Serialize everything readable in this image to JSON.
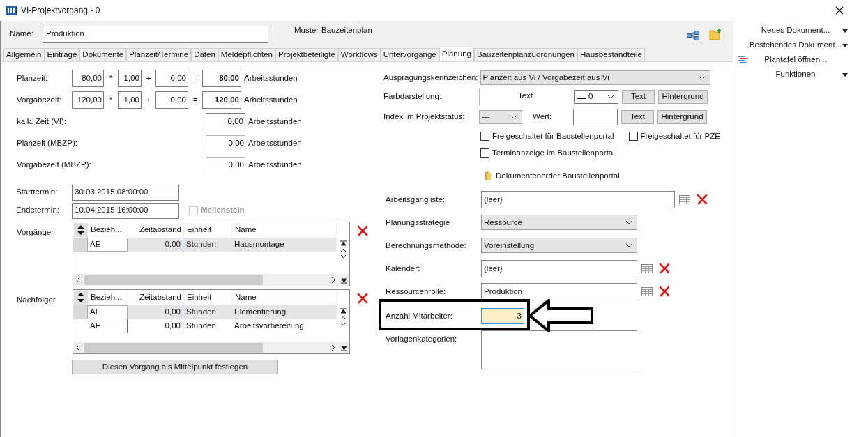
{
  "window": {
    "title": "VI-Projektvorgang - 0"
  },
  "header": {
    "name_label": "Name:",
    "name_value": "Produktion",
    "template": "Muster-Bauzeitenplan"
  },
  "tabs": [
    {
      "label": "Allgemein",
      "selected": false
    },
    {
      "label": "Einträge",
      "selected": false
    },
    {
      "label": "Dokumente",
      "selected": false
    },
    {
      "label": "Planzeit/Termine",
      "selected": false
    },
    {
      "label": "Daten",
      "selected": false
    },
    {
      "label": "Meldepflichten",
      "selected": false
    },
    {
      "label": "Projektbeteiligte",
      "selected": false
    },
    {
      "label": "Workflows",
      "selected": false
    },
    {
      "label": "Untervorgänge",
      "selected": false
    },
    {
      "label": "Planung",
      "selected": true
    },
    {
      "label": "Bauzeitenplanzuordnungen",
      "selected": false
    },
    {
      "label": "Hausbestandteile",
      "selected": false
    }
  ],
  "time_rows": [
    {
      "kind": "formula",
      "label": "Planzeit:",
      "base": "80,00",
      "factor": "1,00",
      "summand": "0,00",
      "result": "80,00",
      "unit": "Arbeitsstunden"
    },
    {
      "kind": "formula",
      "label": "Vorgabezeit:",
      "base": "120,00",
      "factor": "1,00",
      "summand": "0,00",
      "result": "120,00",
      "unit": "Arbeitsstunden"
    },
    {
      "kind": "input",
      "label": "kalk. Zeit (VI):",
      "result": "0,00",
      "unit": "Arbeitsstunden"
    },
    {
      "kind": "readonly",
      "label": "Planzeit (MBZP):",
      "result": "0,00",
      "unit": "Arbeitsstunden"
    },
    {
      "kind": "readonly",
      "label": "Vorgabezeit (MBZP):",
      "result": "0,00",
      "unit": "Arbeitsstunden"
    }
  ],
  "operators": {
    "times": "*",
    "plus": "+",
    "equals": "="
  },
  "dates": [
    {
      "label": "Starttermin:",
      "value": "30.03.2015 08:00:00"
    },
    {
      "label": "Endetermin:",
      "value": "10.04.2015 16:00:00"
    }
  ],
  "milestone": {
    "label": "Meilenstein",
    "checked": false,
    "disabled": true
  },
  "grids": [
    {
      "label": "Vorgänger",
      "columns": [
        "Bezieh...",
        "Zeitabstand",
        "Einheit",
        "Name"
      ],
      "rows": [
        {
          "cells": [
            "AE",
            "0,00",
            "Stunden",
            "Hausmontage"
          ],
          "selected": true
        }
      ]
    },
    {
      "label": "Nachfolger",
      "columns": [
        "Bezieh...",
        "Zeitabstand",
        "Einheit",
        "Name"
      ],
      "rows": [
        {
          "cells": [
            "AE",
            "0,00",
            "Stunden",
            "Elementierung"
          ],
          "selected": true
        },
        {
          "cells": [
            "AE",
            "0,00",
            "Stunden",
            "Arbeitsvorbereitung"
          ],
          "selected": false
        }
      ]
    }
  ],
  "center_button": "Diesen Vorgang als Mittelpunkt festlegen",
  "characteristic": {
    "label": "Ausprägungskennzeichen:",
    "value": "Planzeit aus Vi / Vorgabezeit aus Vi"
  },
  "color_display": {
    "label": "Farbdarstellung:",
    "preview": "Text",
    "line_value": "0",
    "buttons": [
      "Text",
      "Hintergrund"
    ]
  },
  "status_index": {
    "label": "Index im Projektstatus:",
    "value": "---",
    "value_label": "Wert:",
    "buttons": [
      "Text",
      "Hintergrund"
    ]
  },
  "checkboxes": [
    {
      "label": "Freigeschaltet für Baustellenportal",
      "checked": false
    },
    {
      "label": "Freigeschaltet für PZE",
      "checked": false
    },
    {
      "label": "Terminanzeige im Baustellenportal",
      "checked": false
    }
  ],
  "folder_link": "Dokumentenorder Baustellenportal",
  "fields": [
    {
      "kind": "lookup",
      "label": "Arbeitsgangliste:",
      "value": "{leer}",
      "wide": true
    },
    {
      "kind": "select",
      "label": "Planungsstrategie",
      "value": "Ressource"
    },
    {
      "kind": "select",
      "label": "Berechnungsmethode:",
      "value": "Voreinstellung"
    },
    {
      "kind": "lookup",
      "label": "Kalender:",
      "value": "{leer}",
      "wide": false
    },
    {
      "kind": "lookup",
      "label": "Ressourcenrolle:",
      "value": "Produktion",
      "wide": false
    },
    {
      "kind": "number",
      "label": "Anzahl Mitarbeiter:",
      "value": "3",
      "focused": true
    },
    {
      "kind": "multiline",
      "label": "Vorlagenkategorien:"
    }
  ],
  "sidebar": [
    {
      "kind": "menu",
      "label": "Neues Dokument..."
    },
    {
      "kind": "menu",
      "label": "Bestehendes Dokument..."
    },
    {
      "kind": "action",
      "label": "Plantafel öffnen..."
    },
    {
      "kind": "menu",
      "label": "Funktionen"
    }
  ]
}
